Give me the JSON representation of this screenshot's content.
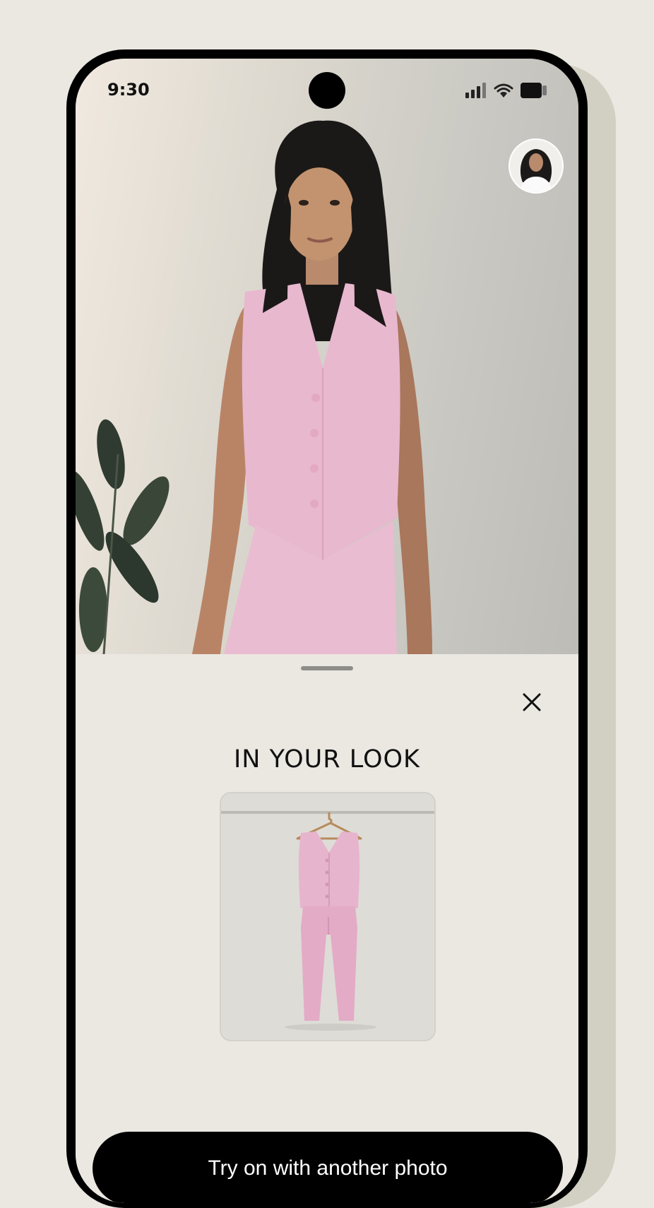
{
  "status_bar": {
    "time": "9:30",
    "icons": [
      "signal-icon",
      "wifi-icon",
      "battery-icon"
    ]
  },
  "photo": {
    "subject": "woman-wearing-pink-vest-and-trousers",
    "avatar_icon": "profile-photo-avatar"
  },
  "sheet": {
    "title": "IN YOUR LOOK",
    "close_icon": "close-icon",
    "product": {
      "image": "pink-vest-and-trouser-set-on-hanger"
    },
    "cta_label": "Try on with another photo"
  },
  "colors": {
    "background": "#ebe8e2",
    "garment_pink": "#e8b8cf",
    "button": "#000000",
    "button_text": "#ffffff"
  }
}
